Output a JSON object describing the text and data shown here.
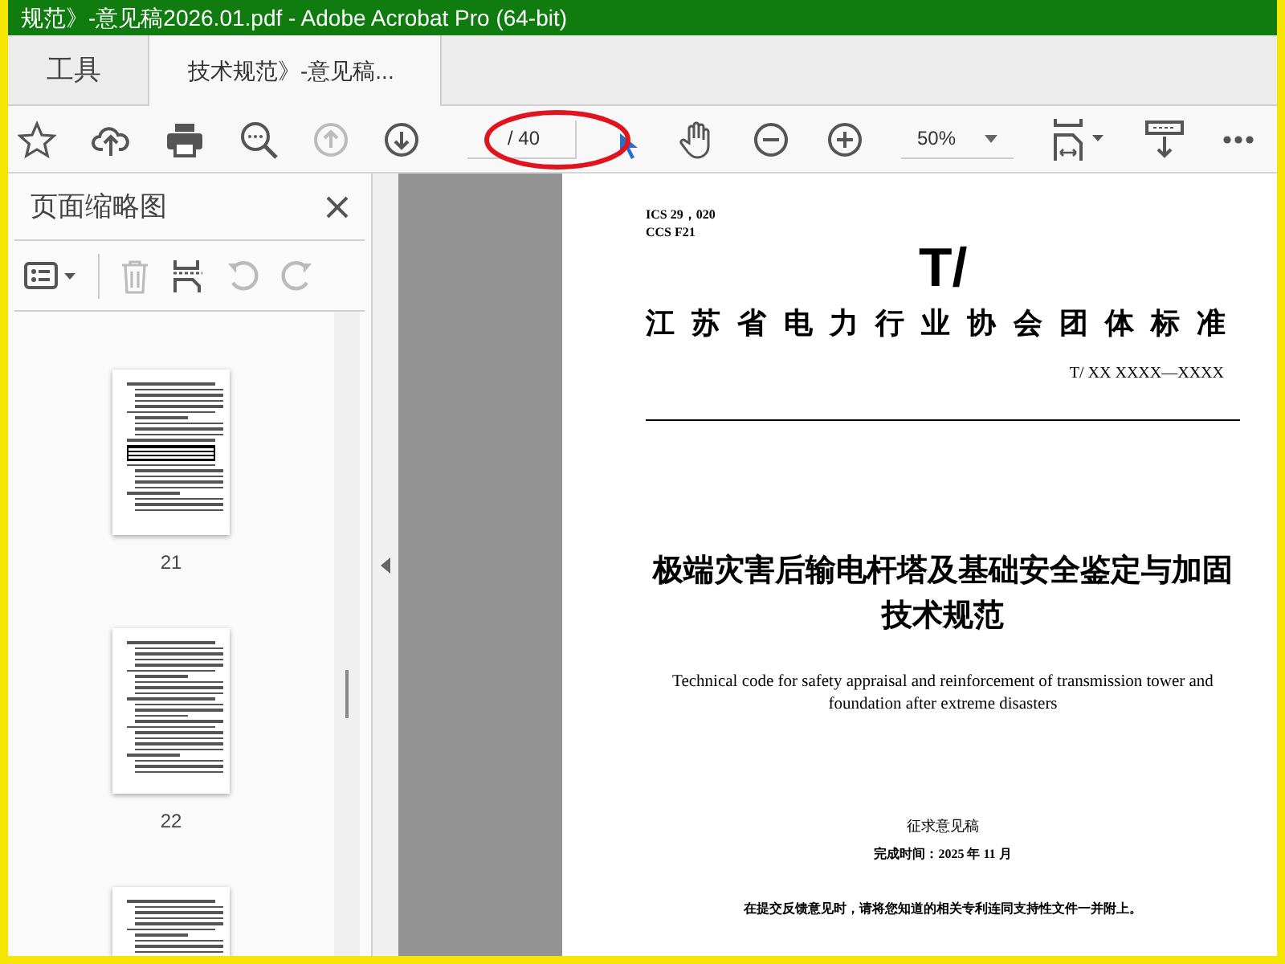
{
  "window": {
    "title": "规范》-意见稿2026.01.pdf - Adobe Acrobat Pro (64-bit)"
  },
  "tabs": [
    {
      "label": "工具",
      "selected": false
    },
    {
      "label": "技术规范》-意见稿...",
      "selected": true
    }
  ],
  "toolbar": {
    "page_total": "/ 40",
    "zoom": "50%",
    "previous_page_disabled": true
  },
  "sidebar": {
    "title": "页面缩略图",
    "thumbnails": [
      {
        "label": "21",
        "has_table": true
      },
      {
        "label": "22",
        "has_table": false
      },
      {
        "label_hidden": true
      }
    ]
  },
  "document": {
    "ics": "ICS  29，020",
    "ccs": "CCS  F21",
    "prefix": "T/",
    "organization": "江苏省电力行业协会团体标准",
    "code": "T/ XX  XXXX—XXXX",
    "title_zh": "极端灾害后输电杆塔及基础安全鉴定与加固技术规范",
    "title_en": "Technical code for safety appraisal and reinforcement of transmission tower and foundation after extreme disasters",
    "stage": "征求意见稿",
    "date": "完成时间：2025 年 11 月",
    "note": "在提交反馈意见时，请将您知道的相关专利连同支持性文件一并附上。"
  }
}
